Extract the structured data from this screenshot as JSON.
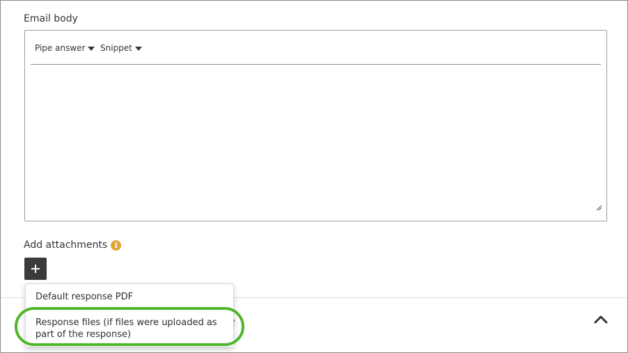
{
  "email_body": {
    "label": "Email body",
    "toolbar": {
      "pipe_answer": "Pipe answer",
      "snippet": "Snippet"
    },
    "content": ""
  },
  "attachments": {
    "label": "Add attachments",
    "info_glyph": "i",
    "add_glyph": "+",
    "dropdown": {
      "items": [
        "Default response PDF",
        "Response files (if files were uploaded as part of the response)"
      ]
    }
  },
  "section": {
    "partial_title": "se"
  },
  "colors": {
    "highlight": "#4fb52b",
    "info": "#e0a43a",
    "button": "#3b3b3b"
  },
  "icons": {
    "toolbar_caret": "caret-down-icon",
    "resize": "resize-handle-icon",
    "info": "info-icon",
    "add": "plus-icon",
    "collapse": "chevron-up-icon"
  }
}
